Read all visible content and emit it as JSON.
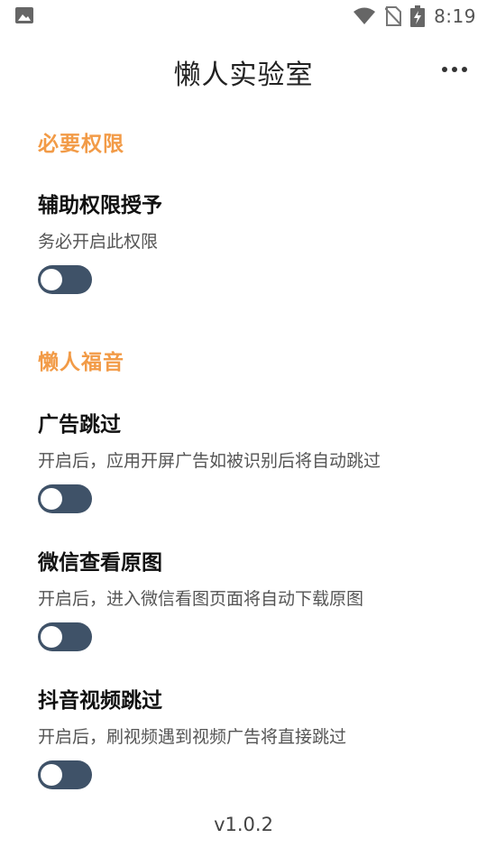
{
  "status_bar": {
    "time": "8:19",
    "icons": [
      "image-icon",
      "wifi-icon",
      "no-sim-icon",
      "battery-charging-icon"
    ]
  },
  "app_bar": {
    "title": "懒人实验室",
    "menu_icon": "more-horizontal-icon"
  },
  "sections": [
    {
      "title": "必要权限",
      "items": [
        {
          "title": "辅助权限授予",
          "desc": "务必开启此权限",
          "enabled": false
        }
      ]
    },
    {
      "title": "懒人福音",
      "items": [
        {
          "title": "广告跳过",
          "desc": "开启后，应用开屏广告如被识别后将自动跳过",
          "enabled": false
        },
        {
          "title": "微信查看原图",
          "desc": "开启后，进入微信看图页面将自动下载原图",
          "enabled": false
        },
        {
          "title": "抖音视频跳过",
          "desc": "开启后，刷视频遇到视频广告将直接跳过",
          "enabled": false
        }
      ]
    }
  ],
  "version": "v1.0.2",
  "colors": {
    "accent": "#f29b47",
    "toggle_track": "#3f5268",
    "toggle_knob": "#ffffff"
  }
}
